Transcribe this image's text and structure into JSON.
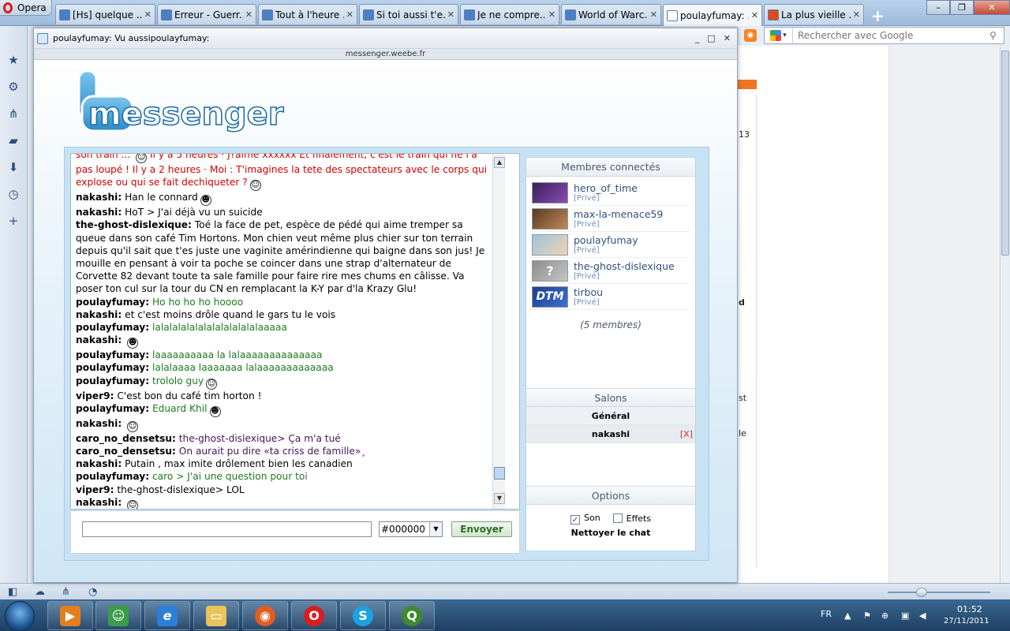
{
  "browser": {
    "menu_label": "Opera",
    "tabs": [
      {
        "label": "[Hs] quelque ...",
        "icon_color": "#4b7fc4"
      },
      {
        "label": "Erreur - Guerr...",
        "icon_color": "#4b7fc4"
      },
      {
        "label": "Tout à l'heure ...",
        "icon_color": "#4b7fc4"
      },
      {
        "label": "Si toi aussi t'e...",
        "icon_color": "#4b7fc4"
      },
      {
        "label": "Je ne compre...",
        "icon_color": "#4b7fc4"
      },
      {
        "label": "World of Warc...",
        "icon_color": "#4b7fc4"
      },
      {
        "label": "poulayfumay: ...",
        "icon_color": "#ffffff",
        "active": true
      },
      {
        "label": "La plus vieille ...",
        "icon_color": "#e04a1a"
      }
    ],
    "search_placeholder": "Rechercher avec Google",
    "bg_page_texts": [
      "13",
      "d",
      "st",
      "le"
    ]
  },
  "popup": {
    "title": "poulayfumay: Vu aussipoulayfumay:",
    "url": "messenger.weebe.fr"
  },
  "logo_text": "messenger",
  "chat": {
    "messages": [
      {
        "nick": "",
        "text": "son train ... ",
        "color": "red",
        "smiley": true,
        "after": " Il y a 5 heures · J?aime xxxxxx Et finalement, c'est le train qui ne l'a pas loupé ! Il y a 2 heures · Moi : T'imagines la tete des spectateurs avec le corps qui explose ou qui se fait dechiqueter ?",
        "smiley2": true
      },
      {
        "nick": "nakashi:",
        "text": "Han le connard",
        "color": "black",
        "smiley": true
      },
      {
        "nick": "nakashi:",
        "text": "HoT > J'ai déjà vu un suicide",
        "color": "black"
      },
      {
        "nick": "the-ghost-dislexique:",
        "text": "Toé la face de pet, espèce de pédé qui aime tremper sa queue dans son café Tim Hortons. Mon chien veut même plus chier sur ton terrain depuis qu'il sait que t'es juste une vaginite amérindienne qui baigne dans son jus! Je mouille en pensant à voir ta poche se coincer dans une strap d'alternateur de Corvette 82 devant toute ta sale famille pour faire rire mes chums en câlisse. Va poser ton cul sur la tour du CN en remplacant la K-Y par d'la Krazy Glu!",
        "color": "black"
      },
      {
        "nick": "poulayfumay:",
        "text": "Ho ho ho ho hoooo",
        "color": "green"
      },
      {
        "nick": "nakashi:",
        "text": "et c'est moins drôle quand le gars tu le vois",
        "color": "black"
      },
      {
        "nick": "poulayfumay:",
        "text": "lalalalalalalalalalalalalaaaaa",
        "color": "green"
      },
      {
        "nick": "nakashi:",
        "text": "",
        "color": "black",
        "smiley": true
      },
      {
        "nick": "poulayfumay:",
        "text": "laaaaaaaaaa la lalaaaaaaaaaaaaaa",
        "color": "green"
      },
      {
        "nick": "poulayfumay:",
        "text": "lalalaaaa laaaaaaa lalaaaaaaaaaaaaa",
        "color": "green"
      },
      {
        "nick": "poulayfumay:",
        "text": "trololo guy",
        "color": "green",
        "smiley": true
      },
      {
        "nick": "viper9:",
        "text": "C'est bon du café tim horton !",
        "color": "black"
      },
      {
        "nick": "poulayfumay:",
        "text": "Eduard Khil",
        "color": "green",
        "smiley": true
      },
      {
        "nick": "nakashi:",
        "text": "",
        "color": "black",
        "smiley": true
      },
      {
        "nick": "caro_no_densetsu:",
        "text": "the-ghost-dislexique> Ça m'a tué",
        "color": "purple"
      },
      {
        "nick": "caro_no_densetsu:",
        "text": "On aurait pu dire «ta criss de famille»¸",
        "color": "purple"
      },
      {
        "nick": "nakashi:",
        "text": "Putain , max imite drôlement bien les canadien",
        "color": "black"
      },
      {
        "nick": "poulayfumay:",
        "text": "caro > J'ai une question pour toi",
        "color": "green"
      },
      {
        "nick": "viper9:",
        "text": "the-ghost-dislexique> LOL",
        "color": "black"
      },
      {
        "nick": "nakashi:",
        "text": "",
        "color": "black",
        "smiley": true
      }
    ],
    "input_value": "",
    "color_value": "#000000",
    "send_label": "Envoyer"
  },
  "sidebar": {
    "members_title": "Membres connectés",
    "members": [
      {
        "name": "hero_of_time",
        "tag": "[Privé]",
        "avatar_colors": [
          "#3a1f5c",
          "#8a4db0"
        ]
      },
      {
        "name": "max-la-menace59",
        "tag": "[Privé]",
        "avatar_colors": [
          "#5a3a22",
          "#c08a5a"
        ]
      },
      {
        "name": "poulayfumay",
        "tag": "[Privé]",
        "avatar_colors": [
          "#9cc7e0",
          "#f0d0b0"
        ]
      },
      {
        "name": "the-ghost-dislexique",
        "tag": "[Privé]",
        "avatar_colors": [
          "#8d8d8d",
          "#c4c4c4"
        ],
        "placeholder": "?"
      },
      {
        "name": "tirbou",
        "tag": "[Privé]",
        "avatar_colors": [
          "#1c3f8a",
          "#3d6fd0"
        ],
        "placeholder": "DTM"
      }
    ],
    "member_count": "(5 membres)",
    "salons_title": "Salons",
    "salons": [
      {
        "name": "Général",
        "closable": false
      },
      {
        "name": "nakashi",
        "closable": true,
        "close_label": "[X]"
      }
    ],
    "options_title": "Options",
    "opt_sound": "Son",
    "opt_sound_checked": true,
    "opt_effects": "Effets",
    "opt_effects_checked": false,
    "clear_label": "Nettoyer le chat"
  },
  "taskbar": {
    "lang": "FR",
    "time": "01:52",
    "date": "27/11/2011"
  }
}
